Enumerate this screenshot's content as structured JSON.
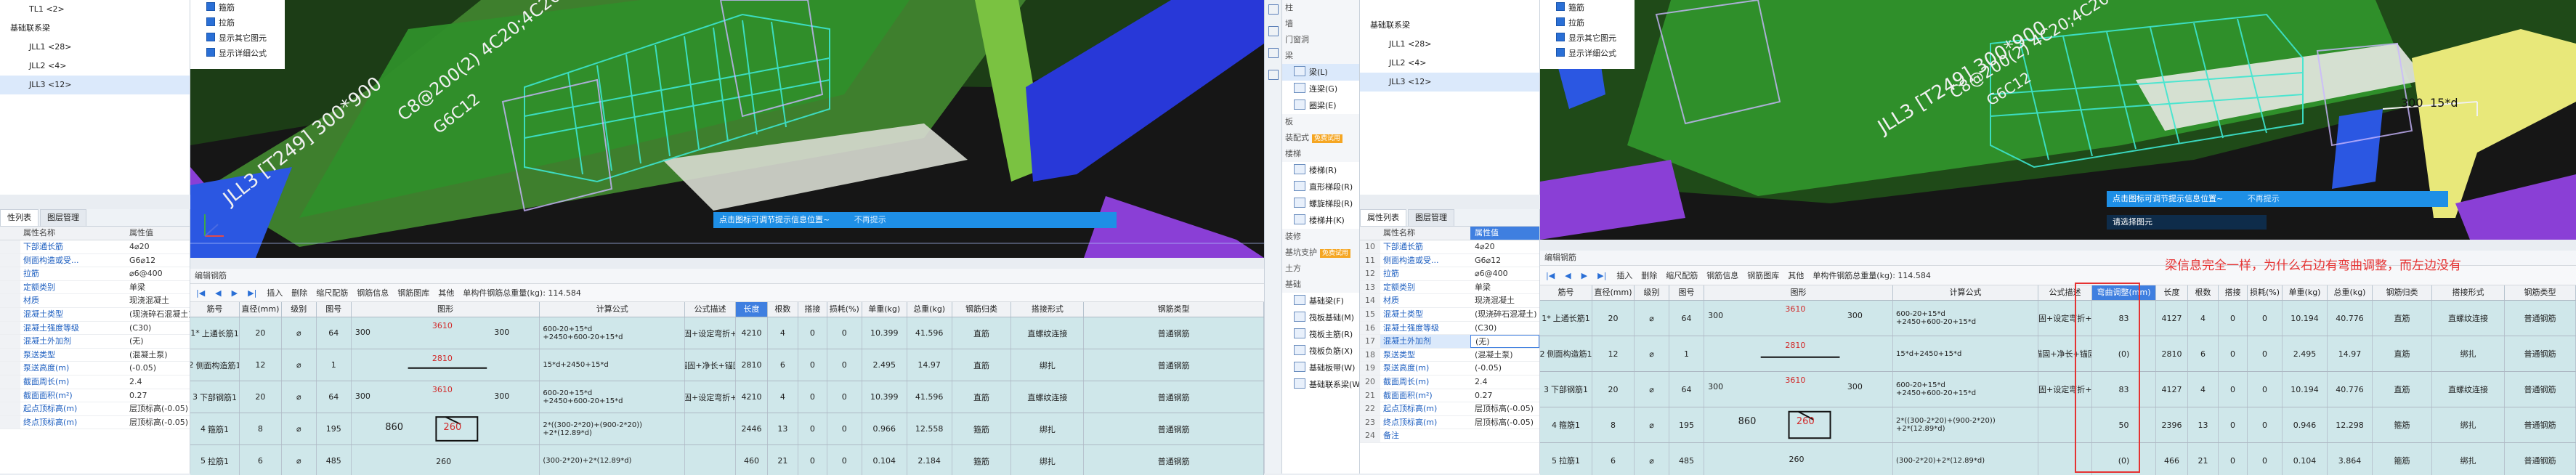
{
  "left": {
    "tree": [
      "TL1 <2>",
      "基础联系梁",
      "JLL1 <28>",
      "JLL2 <4>",
      "JLL3 <12>"
    ],
    "checks": [
      "箍筋",
      "拉筋",
      "显示其它图元",
      "显示详细公式"
    ],
    "annotations": {
      "a1": "JLL3 [T249] 300*900",
      "a2": "C8@200(2) 4C20;4C20",
      "a3": "G6C12"
    },
    "tip": {
      "text": "点击图标可调节提示信息位置~",
      "link": "不再提示"
    },
    "tabs": [
      "性列表",
      "图层管理"
    ],
    "props_header": {
      "name": "属性名称",
      "value": "属性值"
    },
    "props": [
      {
        "n": "下部通长筋",
        "v": "4⌀20"
      },
      {
        "n": "侧面构造或受...",
        "v": "G6⌀12"
      },
      {
        "n": "拉筋",
        "v": "⌀6@400"
      },
      {
        "n": "定额类别",
        "v": "单梁"
      },
      {
        "n": "材质",
        "v": "现浇混凝土"
      },
      {
        "n": "混凝土类型",
        "v": "(现浇碎石混凝土)"
      },
      {
        "n": "混凝土强度等级",
        "v": "(C30)"
      },
      {
        "n": "混凝土外加剂",
        "v": "(无)"
      },
      {
        "n": "泵送类型",
        "v": "(混凝土泵)"
      },
      {
        "n": "泵送高度(m)",
        "v": "(-0.05)"
      },
      {
        "n": "截面周长(m)",
        "v": "2.4"
      },
      {
        "n": "截面面积(m²)",
        "v": "0.27"
      },
      {
        "n": "起点顶标高(m)",
        "v": "层顶标高(-0.05)"
      },
      {
        "n": "终点顶标高(m)",
        "v": "层顶标高(-0.05)"
      }
    ],
    "grid_title": "编辑钢筋",
    "toolbar": [
      "插入",
      "删除",
      "缩尺配筋",
      "钢筋信息",
      "钢筋图库",
      "其他",
      "单构件钢筋总重量(kg): 114.584"
    ],
    "headers": [
      "筋号",
      "直径(mm)",
      "级别",
      "图号",
      "图形",
      "计算公式",
      "公式描述",
      "长度",
      "根数",
      "搭接",
      "损耗(%)",
      "单重(kg)",
      "总重(kg)",
      "钢筋归类",
      "搭接形式",
      "钢筋类型"
    ],
    "rows": [
      {
        "no": "1*",
        "name": "上通长筋1",
        "d": "20",
        "g": "⌀",
        "tu": "64",
        "a": "300",
        "m": "3610",
        "b": "300",
        "f": "600-20+15*d\n+2450+600-20+15*d",
        "desc": "锚固+设定弯折+...",
        "len": "4210",
        "cnt": "4",
        "lap": "0",
        "loss": "0",
        "uw": "10.399",
        "tw": "41.596",
        "cat": "直筋",
        "lt": "直螺纹连接",
        "type": "普通钢筋"
      },
      {
        "no": "2",
        "name": "侧面构造筋1",
        "d": "12",
        "g": "⌀",
        "tu": "1",
        "a": "",
        "m": "2810",
        "b": "",
        "f": "15*d+2450+15*d",
        "desc": "锚固+净长+锚固",
        "len": "2810",
        "cnt": "6",
        "lap": "0",
        "loss": "0",
        "uw": "2.495",
        "tw": "14.97",
        "cat": "直筋",
        "lt": "绑扎",
        "type": "普通钢筋"
      },
      {
        "no": "3",
        "name": "下部钢筋1",
        "d": "20",
        "g": "⌀",
        "tu": "64",
        "a": "300",
        "m": "3610",
        "b": "300",
        "f": "600-20+15*d\n+2450+600-20+15*d",
        "desc": "锚固+设定弯折+...",
        "len": "4210",
        "cnt": "4",
        "lap": "0",
        "loss": "0",
        "uw": "10.399",
        "tw": "41.596",
        "cat": "直筋",
        "lt": "直螺纹连接",
        "type": "普通钢筋"
      },
      {
        "no": "4",
        "name": "箍筋1",
        "d": "8",
        "g": "⌀",
        "tu": "195",
        "a": "860",
        "m": "260",
        "b": "",
        "f": "2*((300-2*20)+(900-2*20))\n+2*(12.89*d)",
        "desc": "",
        "len": "2446",
        "cnt": "13",
        "lap": "0",
        "loss": "0",
        "uw": "0.966",
        "tw": "12.558",
        "cat": "箍筋",
        "lt": "绑扎",
        "type": "普通钢筋"
      },
      {
        "no": "5",
        "name": "拉筋1",
        "d": "6",
        "g": "⌀",
        "tu": "485",
        "a": "",
        "m": "260",
        "b": "",
        "f": "(300-2*20)+2*(12.89*d)",
        "desc": "",
        "len": "460",
        "cnt": "21",
        "lap": "0",
        "loss": "0",
        "uw": "0.104",
        "tw": "2.184",
        "cat": "箍筋",
        "lt": "绑扎",
        "type": "普通钢筋"
      }
    ]
  },
  "mid": {
    "items": [
      {
        "t": "group",
        "l": "柱"
      },
      {
        "t": "group",
        "l": "墙"
      },
      {
        "t": "group",
        "l": "门窗洞"
      },
      {
        "t": "group",
        "l": "梁"
      },
      {
        "t": "item",
        "l": "梁(L)",
        "on": true
      },
      {
        "t": "item",
        "l": "连梁(G)"
      },
      {
        "t": "item",
        "l": "圈梁(E)"
      },
      {
        "t": "group",
        "l": "板"
      },
      {
        "t": "group",
        "l": "装配式",
        "badge": "免费试用"
      },
      {
        "t": "group",
        "l": "楼梯"
      },
      {
        "t": "item",
        "l": "楼梯(R)"
      },
      {
        "t": "item",
        "l": "直形梯段(R)"
      },
      {
        "t": "item",
        "l": "螺旋梯段(R)"
      },
      {
        "t": "item",
        "l": "楼梯井(K)"
      },
      {
        "t": "group",
        "l": "装修"
      },
      {
        "t": "group",
        "l": "基坑支护",
        "badge": "免费试用"
      },
      {
        "t": "group",
        "l": "土方"
      },
      {
        "t": "group",
        "l": "基础"
      },
      {
        "t": "item",
        "l": "基础梁(F)"
      },
      {
        "t": "item",
        "l": "筏板基础(M)"
      },
      {
        "t": "item",
        "l": "筏板主筋(R)"
      },
      {
        "t": "item",
        "l": "筏板负筋(X)"
      },
      {
        "t": "item",
        "l": "基础板带(W)"
      },
      {
        "t": "item",
        "l": "基础联系梁(W)"
      }
    ]
  },
  "right": {
    "tree": [
      "基础联系梁",
      "JLL1 <28>",
      "JLL2 <4>",
      "JLL3 <12>"
    ],
    "checks": [
      "箍筋",
      "拉筋",
      "显示其它图元",
      "显示详细公式"
    ],
    "annotations": {
      "a1": "JLL3 [T249] 300*900",
      "a2": "C8@200(2) 4C20;4C20",
      "a3": "G6C12",
      "dim": "300",
      "dim2": "15*d"
    },
    "tip": {
      "text": "点击图标可调节提示信息位置~",
      "link": "不再提示"
    },
    "tip2": "请选择图元",
    "tabs": [
      "属性列表",
      "图层管理"
    ],
    "props_header": {
      "name": "属性名称",
      "value": "属性值"
    },
    "props": [
      {
        "no": "10",
        "n": "下部通长筋",
        "v": "4⌀20"
      },
      {
        "no": "11",
        "n": "侧面构造或受...",
        "v": "G6⌀12"
      },
      {
        "no": "12",
        "n": "拉筋",
        "v": "⌀6@400"
      },
      {
        "no": "13",
        "n": "定额类别",
        "v": "单梁"
      },
      {
        "no": "14",
        "n": "材质",
        "v": "现浇混凝土"
      },
      {
        "no": "15",
        "n": "混凝土类型",
        "v": "(现浇碎石混凝土)"
      },
      {
        "no": "16",
        "n": "混凝土强度等级",
        "v": "(C30)"
      },
      {
        "no": "17",
        "n": "混凝土外加剂",
        "v": "(无)",
        "sel": true
      },
      {
        "no": "18",
        "n": "泵送类型",
        "v": "(混凝土泵)"
      },
      {
        "no": "19",
        "n": "泵送高度(m)",
        "v": "(-0.05)"
      },
      {
        "no": "20",
        "n": "截面周长(m)",
        "v": "2.4"
      },
      {
        "no": "21",
        "n": "截面面积(m²)",
        "v": "0.27"
      },
      {
        "no": "22",
        "n": "起点顶标高(m)",
        "v": "层顶标高(-0.05)"
      },
      {
        "no": "23",
        "n": "终点顶标高(m)",
        "v": "层顶标高(-0.05)"
      },
      {
        "no": "24",
        "n": "备注",
        "v": ""
      }
    ],
    "grid_title": "编辑钢筋",
    "toolbar": [
      "插入",
      "删除",
      "缩尺配筋",
      "钢筋信息",
      "钢筋图库",
      "其他",
      "单构件钢筋总重量(kg): 114.584"
    ],
    "question": "梁信息完全一样，为什么右边有弯曲调整，而左边没有",
    "headers": [
      "筋号",
      "直径(mm)",
      "级别",
      "图号",
      "图形",
      "计算公式",
      "公式描述",
      "弯曲调整(mm)",
      "长度",
      "根数",
      "搭接",
      "损耗(%)",
      "单重(kg)",
      "总重(kg)",
      "钢筋归类",
      "搭接形式",
      "钢筋类型"
    ],
    "rows": [
      {
        "no": "1*",
        "name": "上通长筋1",
        "d": "20",
        "g": "⌀",
        "tu": "64",
        "a": "300",
        "m": "3610",
        "b": "300",
        "f": "600-20+15*d\n+2450+600-20+15*d",
        "desc": "锚固+设定弯折+...",
        "bend": "83",
        "len": "4127",
        "cnt": "4",
        "lap": "0",
        "loss": "0",
        "uw": "10.194",
        "tw": "40.776",
        "cat": "直筋",
        "lt": "直螺纹连接",
        "type": "普通钢筋"
      },
      {
        "no": "2",
        "name": "侧面构造筋1",
        "d": "12",
        "g": "⌀",
        "tu": "1",
        "a": "",
        "m": "2810",
        "b": "",
        "f": "15*d+2450+15*d",
        "desc": "锚固+净长+锚固",
        "bend": "(0)",
        "len": "2810",
        "cnt": "6",
        "lap": "0",
        "loss": "0",
        "uw": "2.495",
        "tw": "14.97",
        "cat": "直筋",
        "lt": "绑扎",
        "type": "普通钢筋"
      },
      {
        "no": "3",
        "name": "下部钢筋1",
        "d": "20",
        "g": "⌀",
        "tu": "64",
        "a": "300",
        "m": "3610",
        "b": "300",
        "f": "600-20+15*d\n+2450+600-20+15*d",
        "desc": "锚固+设定弯折+...",
        "bend": "83",
        "len": "4127",
        "cnt": "4",
        "lap": "0",
        "loss": "0",
        "uw": "10.194",
        "tw": "40.776",
        "cat": "直筋",
        "lt": "直螺纹连接",
        "type": "普通钢筋"
      },
      {
        "no": "4",
        "name": "箍筋1",
        "d": "8",
        "g": "⌀",
        "tu": "195",
        "a": "860",
        "m": "260",
        "b": "",
        "f": "2*((300-2*20)+(900-2*20))\n+2*(12.89*d)",
        "desc": "",
        "bend": "50",
        "len": "2396",
        "cnt": "13",
        "lap": "0",
        "loss": "0",
        "uw": "0.946",
        "tw": "12.298",
        "cat": "箍筋",
        "lt": "绑扎",
        "type": "普通钢筋"
      },
      {
        "no": "5",
        "name": "拉筋1",
        "d": "6",
        "g": "⌀",
        "tu": "485",
        "a": "",
        "m": "260",
        "b": "",
        "f": "(300-2*20)+2*(12.89*d)",
        "desc": "",
        "bend": "(0)",
        "len": "466",
        "cnt": "21",
        "lap": "0",
        "loss": "0",
        "uw": "0.104",
        "tw": "3.864",
        "cat": "箍筋",
        "lt": "绑扎",
        "type": "普通钢筋"
      }
    ]
  },
  "colors": {
    "viewport": "#1a1a1a",
    "grid_row": "#cfe7ea",
    "accent": "#1e8fe6",
    "highlight_col": "#3f7fe0",
    "question": "#e53232",
    "beam_green": "#2f8f2a",
    "beam_blue": "#2838d8",
    "purple": "#8a3fd6"
  }
}
